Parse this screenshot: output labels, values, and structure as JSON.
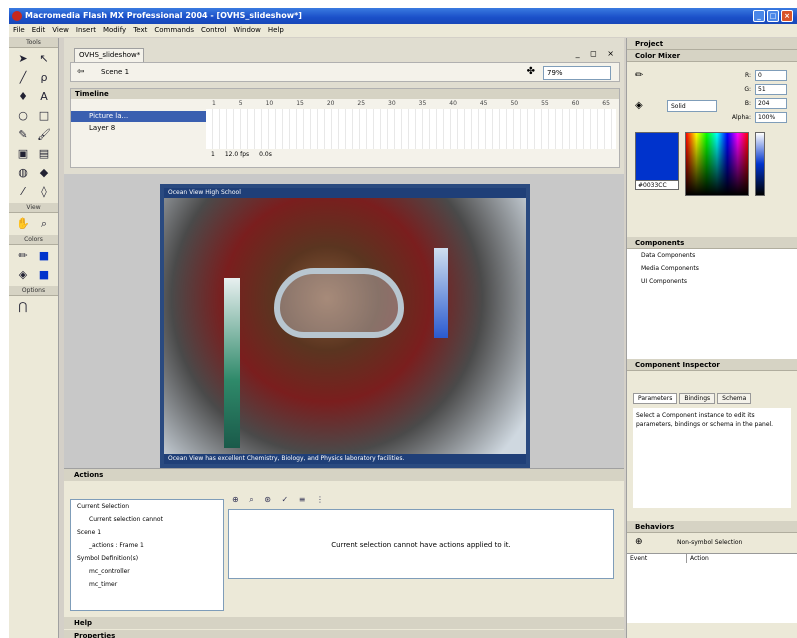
{
  "window": {
    "title": "Macromedia Flash MX Professional 2004 - [OVHS_slideshow*]"
  },
  "menu": [
    "File",
    "Edit",
    "View",
    "Insert",
    "Modify",
    "Text",
    "Commands",
    "Control",
    "Window",
    "Help"
  ],
  "tools": {
    "header": "Tools",
    "view_label": "View",
    "colors_label": "Colors",
    "options_label": "Options"
  },
  "document": {
    "tab": "OVHS_slideshow*",
    "scene": "Scene 1",
    "zoom": "79%"
  },
  "timeline": {
    "header": "Timeline",
    "layers": [
      "Picture la...",
      "Layer 8"
    ],
    "ruler": [
      "1",
      "5",
      "10",
      "15",
      "20",
      "25",
      "30",
      "35",
      "40",
      "45",
      "50",
      "55",
      "60",
      "65"
    ],
    "frame": "1",
    "fps": "12.0 fps",
    "time": "0.0s"
  },
  "stage": {
    "caption_top": "Ocean View High School",
    "caption_bottom": "Ocean View has excellent Chemistry, Biology, and Physics laboratory facilities."
  },
  "actions": {
    "header": "Actions",
    "tree": [
      "Current Selection",
      "Current selection cannot",
      "Scene 1",
      "_actions : Frame 1",
      "Symbol Definition(s)",
      "mc_controller",
      "mc_timer"
    ],
    "message": "Current selection cannot have actions applied to it."
  },
  "bottom": {
    "help": "Help",
    "properties": "Properties"
  },
  "right": {
    "project": "Project",
    "color_mixer": "Color Mixer",
    "fill_type": "Solid",
    "r": "0",
    "g": "51",
    "b": "204",
    "alpha": "100%",
    "hex": "#0033CC",
    "components": "Components",
    "component_items": [
      "Data Components",
      "Media Components",
      "UI Components"
    ],
    "inspector": "Component Inspector",
    "inspector_tabs": [
      "Parameters",
      "Bindings",
      "Schema"
    ],
    "inspector_msg": "Select a Component instance to edit its parameters, bindings or schema in the panel.",
    "behaviors": "Behaviors",
    "behaviors_sel": "Non-symbol Selection",
    "behaviors_cols": [
      "Event",
      "Action"
    ]
  }
}
